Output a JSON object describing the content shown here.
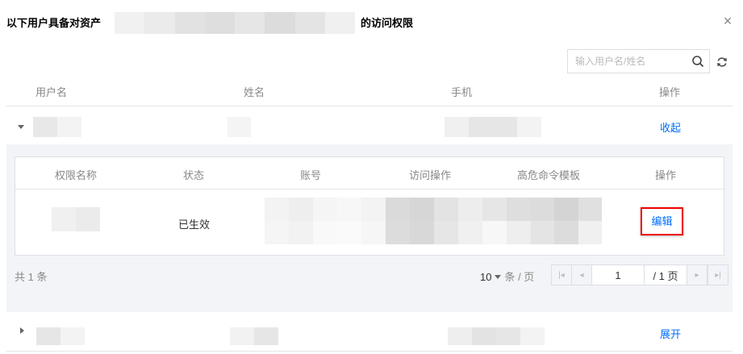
{
  "dialog": {
    "title_prefix": "以下用户具备对资产",
    "title_suffix": "的访问权限",
    "close_icon": "×"
  },
  "search": {
    "placeholder": "输入用户名/姓名",
    "value": ""
  },
  "table": {
    "columns": [
      "用户名",
      "姓名",
      "手机",
      "操作"
    ],
    "rows": [
      {
        "action": "收起",
        "expanded": true
      },
      {
        "action": "展开",
        "expanded": false
      }
    ]
  },
  "permission_table": {
    "columns": [
      "权限名称",
      "状态",
      "账号",
      "访问操作",
      "高危命令模板",
      "操作"
    ],
    "row": {
      "status": "已生效",
      "action": "编辑"
    }
  },
  "pagination": {
    "total_text": "共 1 条",
    "page_size": "10",
    "page_size_unit": "条 / 页",
    "current_page": "1",
    "total_pages": "/ 1 页"
  },
  "colors": {
    "link": "#006eff",
    "highlight_border": "#ee0000",
    "panel_bg": "#f3f4f7",
    "blur_light": "#f2f2f2",
    "blur_dark": "#d4d4d4"
  }
}
